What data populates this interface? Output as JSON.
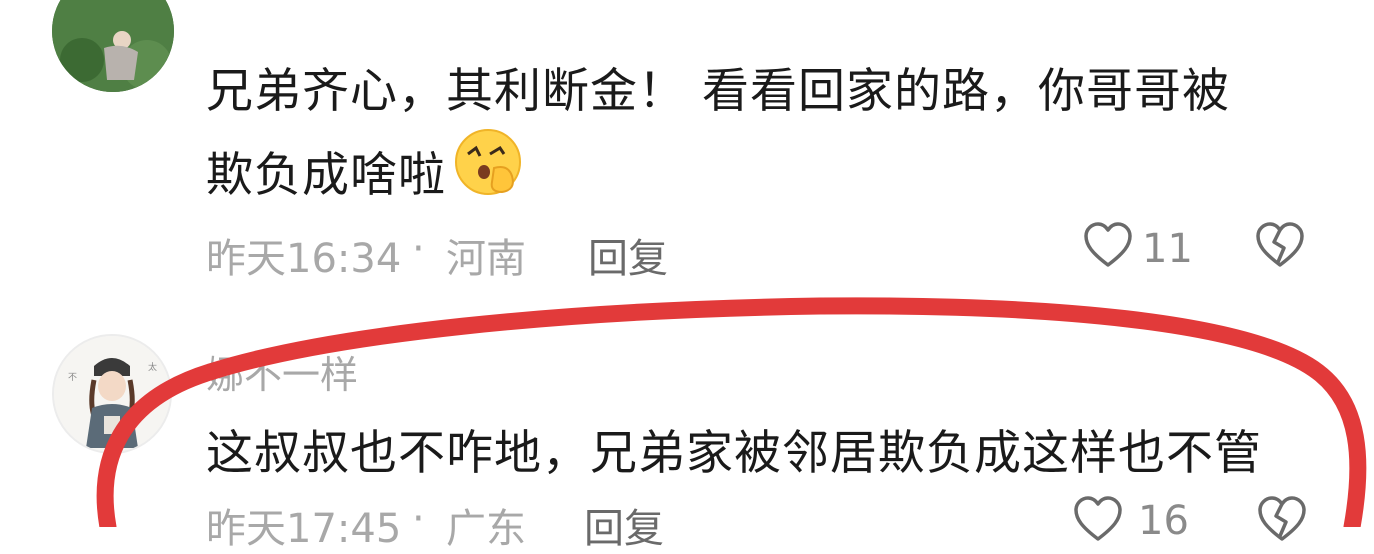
{
  "comments": [
    {
      "text_line1": "兄弟齐心，其利断金！  看看回家的路，你哥哥被",
      "text_line2": "欺负成啥啦",
      "emoji": "shushing-face",
      "time": "昨天16:34",
      "separator": "·",
      "location": "河南",
      "reply_label": "回复",
      "like_count": "11"
    },
    {
      "username": "娜不一样",
      "text": "这叔叔也不咋地，兄弟家被邻居欺负成这样也不管",
      "time": "昨天17:45",
      "separator": "·",
      "location": "广东",
      "reply_label": "回复",
      "like_count": "16"
    }
  ],
  "annotation": {
    "color": "#e23a3a"
  },
  "icons": {
    "like": "heart-outline-icon",
    "dislike": "broken-heart-icon"
  }
}
